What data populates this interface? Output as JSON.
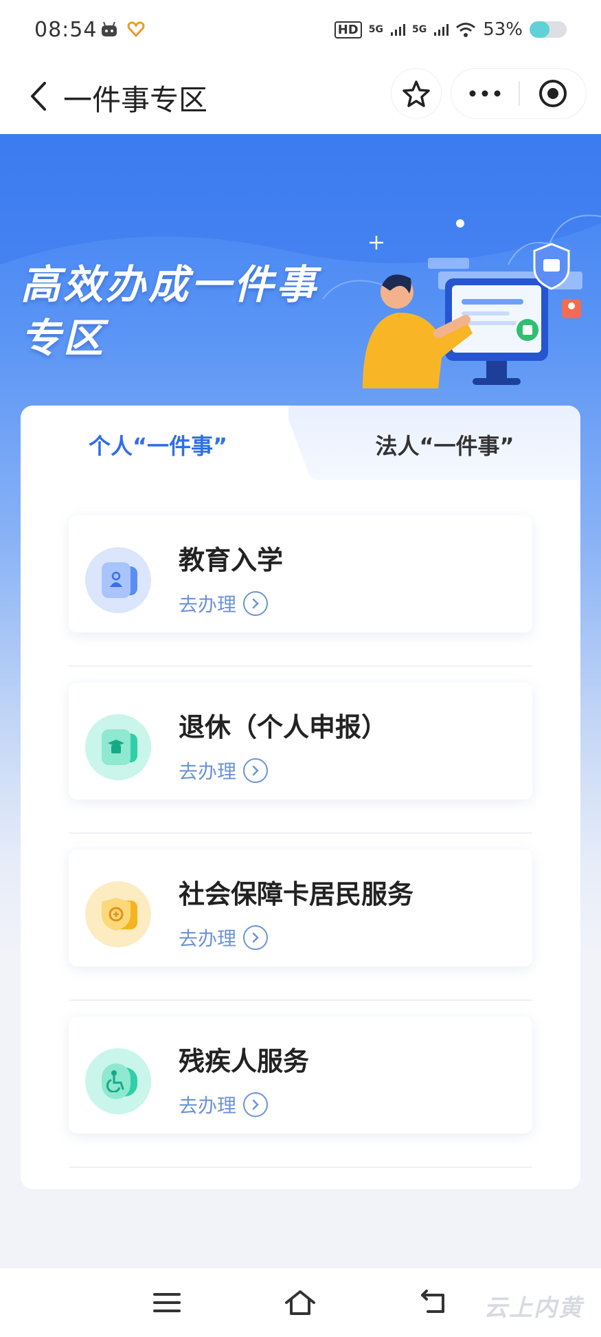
{
  "status_bar": {
    "time": "08:54",
    "network_labels": [
      "HD",
      "5G",
      "5G"
    ],
    "battery_text": "53%",
    "battery_level": 0.53
  },
  "nav": {
    "title": "一件事专区"
  },
  "hero": {
    "title_line1": "高效办成一件事",
    "title_line2": "专区"
  },
  "tabs": [
    {
      "label": "个人“一件事”",
      "active": true
    },
    {
      "label": "法人“一件事”",
      "active": false
    }
  ],
  "items": [
    {
      "title": "教育入学",
      "action": "去办理",
      "icon": "education-icon",
      "color": "#8fb2f5"
    },
    {
      "title": "退休（个人申报）",
      "action": "去办理",
      "icon": "retirement-icon",
      "color": "#63dcc3"
    },
    {
      "title": "社会保障卡居民服务",
      "action": "去办理",
      "icon": "social-security-card-icon",
      "color": "#f7c95a"
    },
    {
      "title": "残疾人服务",
      "action": "去办理",
      "icon": "disability-service-icon",
      "color": "#63dcc3"
    }
  ],
  "watermark": "云上内黄",
  "colors": {
    "accent": "#2f6fe6",
    "action_link": "#6b93d6",
    "hero_blue": "#3d7ff3"
  }
}
